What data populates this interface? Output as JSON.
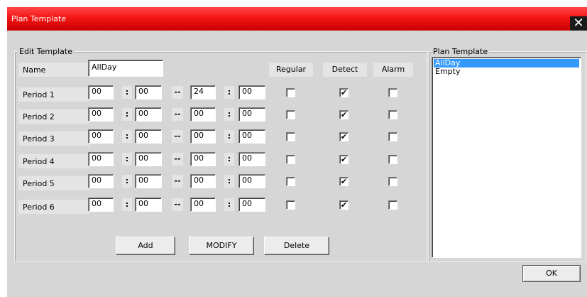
{
  "window": {
    "title": "Plan Template"
  },
  "edit": {
    "legend": "Edit Template",
    "name_label": "Name",
    "name_value": "AllDay",
    "headers": {
      "regular": "Regular",
      "detect": "Detect",
      "alarm": "Alarm"
    },
    "colon": ":",
    "dash": "--",
    "periods": [
      {
        "label": "Period 1",
        "start_h": "00",
        "start_m": "00",
        "end_h": "24",
        "end_m": "00",
        "regular": false,
        "detect": true,
        "alarm": false
      },
      {
        "label": "Period 2",
        "start_h": "00",
        "start_m": "00",
        "end_h": "00",
        "end_m": "00",
        "regular": false,
        "detect": true,
        "alarm": false
      },
      {
        "label": "Period 3",
        "start_h": "00",
        "start_m": "00",
        "end_h": "00",
        "end_m": "00",
        "regular": false,
        "detect": true,
        "alarm": false
      },
      {
        "label": "Period 4",
        "start_h": "00",
        "start_m": "00",
        "end_h": "00",
        "end_m": "00",
        "regular": false,
        "detect": true,
        "alarm": false
      },
      {
        "label": "Period 5",
        "start_h": "00",
        "start_m": "00",
        "end_h": "00",
        "end_m": "00",
        "regular": false,
        "detect": true,
        "alarm": false
      },
      {
        "label": "Period 6",
        "start_h": "00",
        "start_m": "00",
        "end_h": "00",
        "end_m": "00",
        "regular": false,
        "detect": true,
        "alarm": false
      }
    ],
    "buttons": {
      "add": "Add",
      "modify": "MODIFY",
      "delete": "Delete"
    }
  },
  "plan": {
    "legend": "Plan Template",
    "items": [
      {
        "label": "AllDay",
        "selected": true
      },
      {
        "label": "Empty",
        "selected": false
      }
    ]
  },
  "footer": {
    "ok": "OK"
  },
  "icons": {
    "close": "close-icon",
    "checkmark": "checkmark-icon"
  },
  "colors": {
    "titlebar": "#f41515",
    "selection": "#3399ff",
    "dialog": "#d6d6d6"
  }
}
